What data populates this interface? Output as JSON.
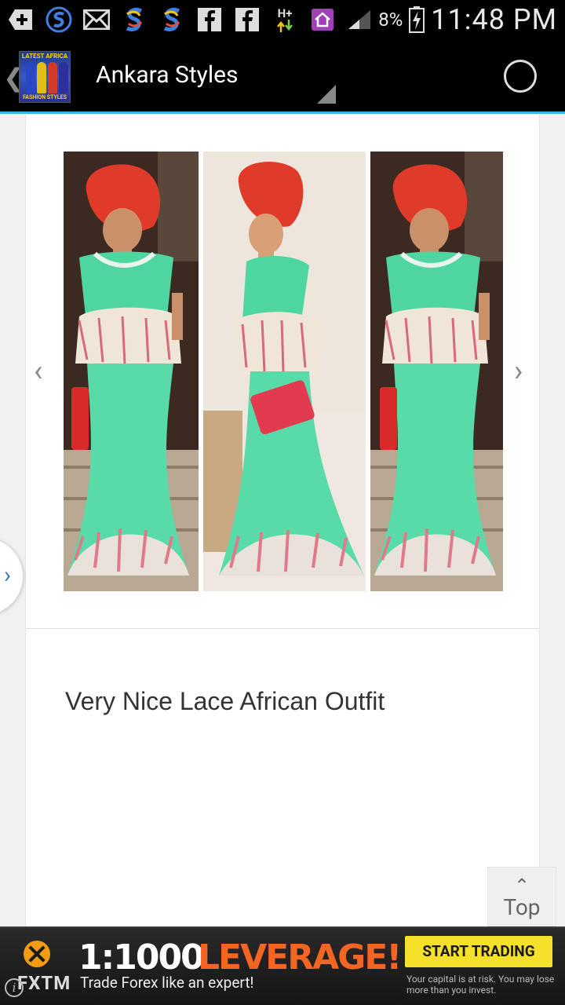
{
  "status_bar": {
    "battery_percent": "8%",
    "network": "H+",
    "time": "11:48 PM",
    "icons": [
      "plus-icon",
      "s-app-icon",
      "mail-icon",
      "s-sync-icon",
      "s-sync-icon",
      "facebook-icon",
      "facebook-icon",
      "network-h-plus-icon",
      "home-icon",
      "signal-icon",
      "battery-charging-icon"
    ]
  },
  "action_bar": {
    "back_glyph": "❮",
    "logo_text_top": "LATEST AFRICA",
    "logo_text_bottom": "FASHION STYLES",
    "title": "Ankara Styles"
  },
  "gallery": {
    "prev_glyph": "‹",
    "next_glyph": "›",
    "caption": "Very Nice Lace African Outfit"
  },
  "side_tab": {
    "glyph": "›"
  },
  "top_button": {
    "arrow": "⌃",
    "label": "Top"
  },
  "ad": {
    "brand": "FXTM",
    "info_glyph": "i",
    "headline_ratio": "1:1000",
    "headline_word": "LEVERAGE!",
    "subline": "Trade Forex like an expert!",
    "cta": "START TRADING",
    "disclaimer": "Your capital is at risk. You may lose more than you invest."
  },
  "colors": {
    "accent_line": "#33b5e5",
    "ad_orange": "#f26522",
    "ad_cta_yellow": "#f5e02a",
    "dress_green": "#4fd6a0",
    "gele_red": "#e03a2a"
  }
}
